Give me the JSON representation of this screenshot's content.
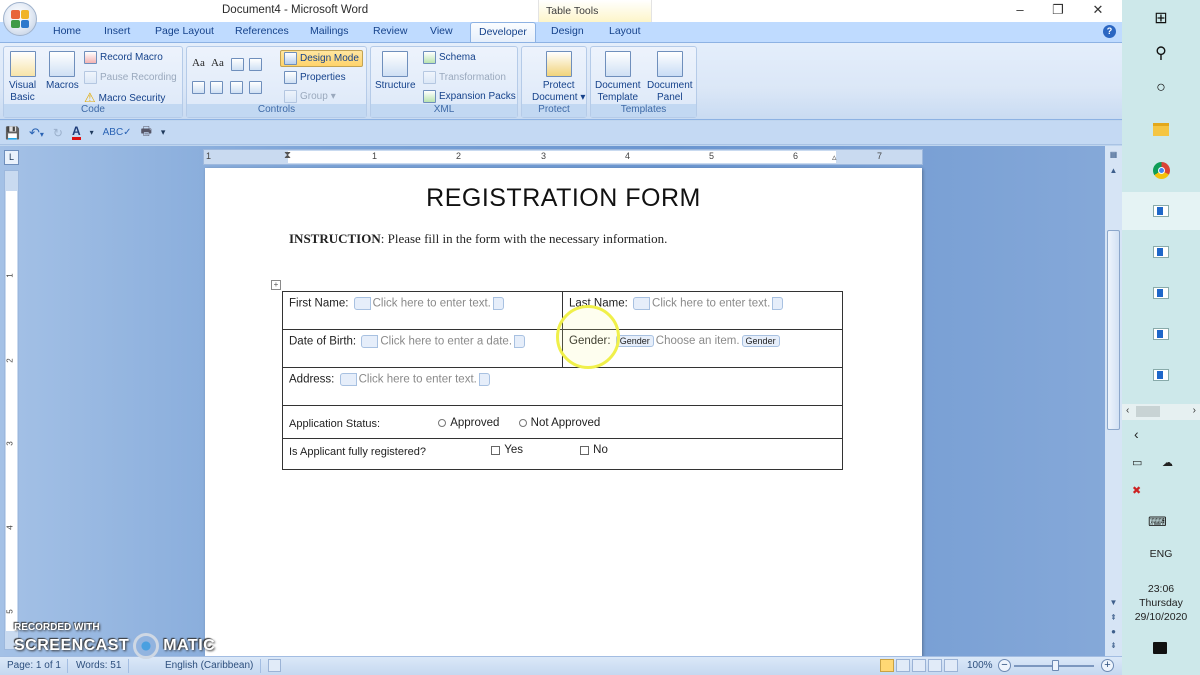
{
  "window": {
    "title": "Document4 - Microsoft Word",
    "contextual_group": "Table Tools",
    "controls": {
      "minimize": "–",
      "restore": "❐",
      "close": "✕"
    }
  },
  "ribbon_tabs": [
    {
      "label": "Home"
    },
    {
      "label": "Insert"
    },
    {
      "label": "Page Layout"
    },
    {
      "label": "References"
    },
    {
      "label": "Mailings"
    },
    {
      "label": "Review"
    },
    {
      "label": "View"
    },
    {
      "label": "Developer",
      "active": true
    },
    {
      "label": "Design"
    },
    {
      "label": "Layout"
    }
  ],
  "ribbon": {
    "code": {
      "label": "Code",
      "visual_basic": "Visual Basic",
      "visual_basic_l1": "Visual",
      "visual_basic_l2": "Basic",
      "macros": "Macros",
      "record_macro": "Record Macro",
      "pause_recording": "Pause Recording",
      "macro_security": "Macro Security"
    },
    "controls": {
      "label": "Controls",
      "design_mode": "Design Mode",
      "properties": "Properties",
      "group": "Group",
      "aa1": "Aa",
      "aa2": "Aa"
    },
    "xml": {
      "label": "XML",
      "structure": "Structure",
      "schema": "Schema",
      "transformation": "Transformation",
      "expansion_packs": "Expansion Packs"
    },
    "protect": {
      "label": "Protect",
      "protect_document_l1": "Protect",
      "protect_document_l2": "Document ▾"
    },
    "templates": {
      "label": "Templates",
      "document_template_l1": "Document",
      "document_template_l2": "Template",
      "document_panel_l1": "Document",
      "document_panel_l2": "Panel"
    }
  },
  "quick_access": [
    "save-icon",
    "undo-icon",
    "redo-icon",
    "font-color-icon",
    "spelling-icon",
    "print-preview-icon",
    "customize-icon"
  ],
  "ruler": {
    "h_numbers": [
      "1",
      "1",
      "2",
      "3",
      "4",
      "5",
      "6",
      "7"
    ],
    "v_numbers": [
      "1",
      "2",
      "3",
      "4",
      "5"
    ],
    "corner": "L"
  },
  "document": {
    "title": "REGISTRATION FORM",
    "instruction_label": "INSTRUCTION",
    "instruction_text": ": Please fill in the form with the necessary information.",
    "form": {
      "first_name_label": "First Name:",
      "first_name_placeholder": "Click here to enter text.",
      "last_name_label": "Last Name:",
      "last_name_placeholder": "Click here to enter text.",
      "dob_label": "Date of Birth:",
      "dob_placeholder": "Click here to enter a date.",
      "gender_label": "Gender:",
      "gender_tag": "Gender",
      "gender_placeholder": "Choose an item.",
      "address_label": "Address:",
      "address_placeholder": "Click here to enter text.",
      "status_label": "Application Status:",
      "status_options": [
        "Approved",
        "Not Approved"
      ],
      "registered_label": "Is Applicant fully registered?",
      "registered_options": [
        "Yes",
        "No"
      ]
    }
  },
  "status_bar": {
    "page": "Page: 1 of 1",
    "words": "Words: 51",
    "language": "English (Caribbean)",
    "zoom": "100%",
    "zoom_value_percent": 100
  },
  "watermark": {
    "line1": "RECORDED WITH",
    "line2a": "SCREENCAST",
    "line2b": "MATIC"
  },
  "taskbar": {
    "language": "ENG",
    "time": "23:06",
    "day": "Thursday",
    "date": "29/10/2020",
    "pinned": [
      "windows-start-icon",
      "search-icon",
      "cortana-icon",
      "file-explorer-icon",
      "chrome-icon",
      "word-window-icon",
      "word-window-icon",
      "word-window-icon",
      "word-window-icon",
      "word-window-icon"
    ]
  }
}
